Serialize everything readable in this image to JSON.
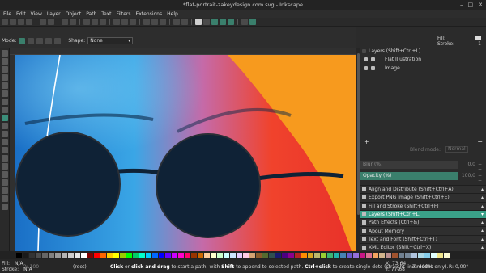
{
  "window": {
    "title": "*flat-portrait-zakeydesign.com.svg - Inkscape",
    "controls": [
      "–",
      "□",
      "✕"
    ]
  },
  "menu": [
    "File",
    "Edit",
    "View",
    "Layer",
    "Object",
    "Path",
    "Text",
    "Filters",
    "Extensions",
    "Help"
  ],
  "tool_controls": {
    "mode_label": "Mode:",
    "shape_label": "Shape:",
    "shape_value": "None"
  },
  "top_fillstroke": {
    "fill_label": "Fill:",
    "stroke_label": "Stroke:",
    "stroke_value": "1"
  },
  "layers": {
    "header": "Layers (Shift+Ctrl+L)",
    "items": [
      {
        "name": "Flat Illustration"
      },
      {
        "name": "Image"
      }
    ],
    "blend_label": "Blend mode:",
    "blend_value": "Normal",
    "blur_label": "Blur (%)",
    "blur_value": "0,0",
    "opacity_label": "Opacity (%)",
    "opacity_value": "100,0",
    "toolbar_add": "+",
    "toolbar_remove": "−"
  },
  "dock_tabs": [
    {
      "label": "Align and Distribute (Shift+Ctrl+A)",
      "active": false
    },
    {
      "label": "Export PNG Image (Shift+Ctrl+E)",
      "active": false
    },
    {
      "label": "Fill and Stroke (Shift+Ctrl+F)",
      "active": false
    },
    {
      "label": "Layers (Shift+Ctrl+L)",
      "active": true
    },
    {
      "label": "Path Effects (Ctrl+&)",
      "active": false
    },
    {
      "label": "About Memory",
      "active": false
    },
    {
      "label": "Text and Font (Shift+Ctrl+T)",
      "active": false
    },
    {
      "label": "XML Editor (Shift+Ctrl+X)",
      "active": false
    }
  ],
  "status": {
    "fill_label": "Fill:",
    "fill_value": "N/A",
    "stroke_label": "Stroke:",
    "stroke_value": "N/A",
    "opacity_label": "O:",
    "opacity_value": "100",
    "layer_value": "(root)",
    "message_bold1": "Click",
    "message_t1": " or ",
    "message_bold2": "click and drag",
    "message_t2": " to start a path; with ",
    "message_bold3": "Shift",
    "message_t3": " to append to selected path. ",
    "message_bold4": "Ctrl+click",
    "message_t4": " to create single dots (straight line modes only).",
    "x_label": "X:",
    "x_value": "73,64",
    "y_label": "Y:",
    "y_value": "77,68",
    "zoom_label": "Z:",
    "zoom_value": "400%",
    "rotation_label": "R:",
    "rotation_value": "0,00°"
  },
  "colors": {
    "accent": "#3aa088",
    "canvas_blue": "#1d7fd0",
    "canvas_orange": "#f79a1e",
    "canvas_red": "#e8312a",
    "lens": "#0f2236"
  },
  "palette": [
    "#000000",
    "#1a1a1a",
    "#333333",
    "#4d4d4d",
    "#666666",
    "#808080",
    "#999999",
    "#b3b3b3",
    "#cccccc",
    "#e6e6e6",
    "#ffffff",
    "#800000",
    "#ff0000",
    "#ff6600",
    "#ffcc00",
    "#ffff00",
    "#99cc00",
    "#00ff00",
    "#00cc66",
    "#00ffcc",
    "#00ccff",
    "#0066ff",
    "#0000ff",
    "#6600ff",
    "#cc00ff",
    "#ff00cc",
    "#ff0066",
    "#993300",
    "#cc6600",
    "#ffcc99",
    "#ffffcc",
    "#ccffcc",
    "#ccffff",
    "#cce5ff",
    "#e5ccff",
    "#ffcce5",
    "#d4a373",
    "#8b5a2b",
    "#556b2f",
    "#2f4f4f",
    "#191970",
    "#4b0082",
    "#8b008b",
    "#b22222",
    "#ff8c00",
    "#daa520",
    "#bdb76b",
    "#9acd32",
    "#3cb371",
    "#20b2aa",
    "#4682b4",
    "#6a5acd",
    "#9370db",
    "#c71585",
    "#db7093",
    "#f4a460",
    "#d2b48c",
    "#bc8f8f",
    "#a0522d",
    "#708090",
    "#778899",
    "#b0c4de",
    "#add8e6",
    "#87ceeb",
    "#e0ffff",
    "#f0e68c",
    "#fafad2"
  ]
}
